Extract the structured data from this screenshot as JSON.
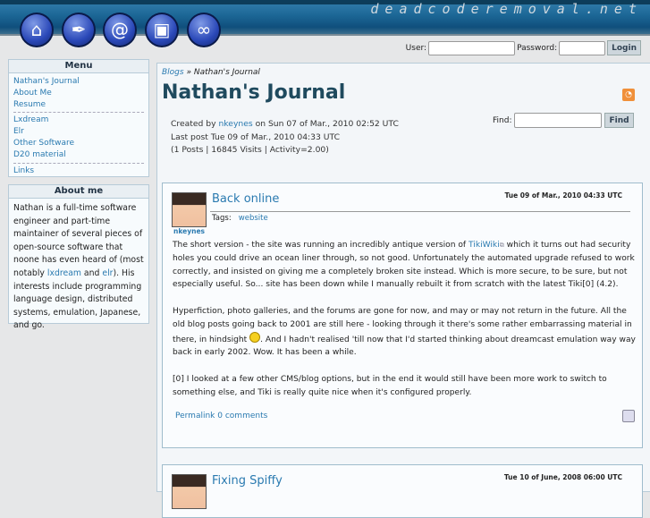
{
  "header": {
    "site_name": "deadcoderemoval.net",
    "nav_icons": [
      "home-icon",
      "quill-icon",
      "spiral-icon",
      "box-icon",
      "link-icon"
    ]
  },
  "login": {
    "user_label": "User:",
    "password_label": "Password:",
    "button": "Login"
  },
  "menu": {
    "title": "Menu",
    "groups": [
      [
        "Nathan's Journal",
        "About Me",
        "Resume"
      ],
      [
        "Lxdream",
        "Elr",
        "Other Software",
        "D20 material"
      ],
      [
        "Links"
      ]
    ]
  },
  "about": {
    "title": "About me",
    "text_1": "Nathan is a full-time software engineer and part-time maintainer of several pieces of open-source software that noone has even heard of (most notably ",
    "link_1": "lxdream",
    "and": " and ",
    "link_2": "elr",
    "text_2": "). His interests include programming language design, distributed systems, emulation, Japanese, and go."
  },
  "blog": {
    "breadcrumb_root": "Blogs",
    "breadcrumb_sep": "»",
    "breadcrumb_current": "Nathan's Journal",
    "title": "Nathan's Journal",
    "created_prefix": "Created by ",
    "created_by": "nkeynes",
    "created_suffix": " on Sun 07 of Mar., 2010 02:52 UTC",
    "last_post": "Last post Tue 09 of Mar., 2010 04:33 UTC",
    "stats": "(1 Posts | 16845 Visits | Activity=2.00)",
    "find_label": "Find:",
    "find_button": "Find"
  },
  "posts": [
    {
      "title": "Back online",
      "date": "Tue 09 of Mar., 2010 04:33 UTC",
      "tags_label": "Tags:",
      "tag": "website",
      "author": "nkeynes",
      "p1a": "The short version - the site was running an incredibly antique version of ",
      "p1link": "TikiWiki",
      "p1b": " which it turns out had security holes you could drive an ocean liner through, so not good. Unfortunately the automated upgrade refused to work correctly, and insisted on giving me a completely broken site instead. Which is more secure, to be sure, but not especially useful. So... site has been down while I manually rebuilt it from scratch with the latest Tiki[0] (4.2).",
      "p2a": "Hyperfiction, photo galleries, and the forums are gone for now, and may or may not return in the future. All the old blog posts going back to 2001 are still here - looking through it there's some rather embarrassing material in there, in hindsight ",
      "p2b": ". And I hadn't realised 'till now that I'd started thinking about dreamcast emulation way way back in early 2002. Wow. It has been a while.",
      "p3": "[0] I looked at a few other CMS/blog options, but in the end it would still have been more work to switch to something else, and Tiki is really quite nice when it's configured properly.",
      "permalink": "Permalink",
      "comments": "0 comments"
    },
    {
      "title": "Fixing Spiffy",
      "date": "Tue 10 of June, 2008 06:00 UTC"
    }
  ]
}
